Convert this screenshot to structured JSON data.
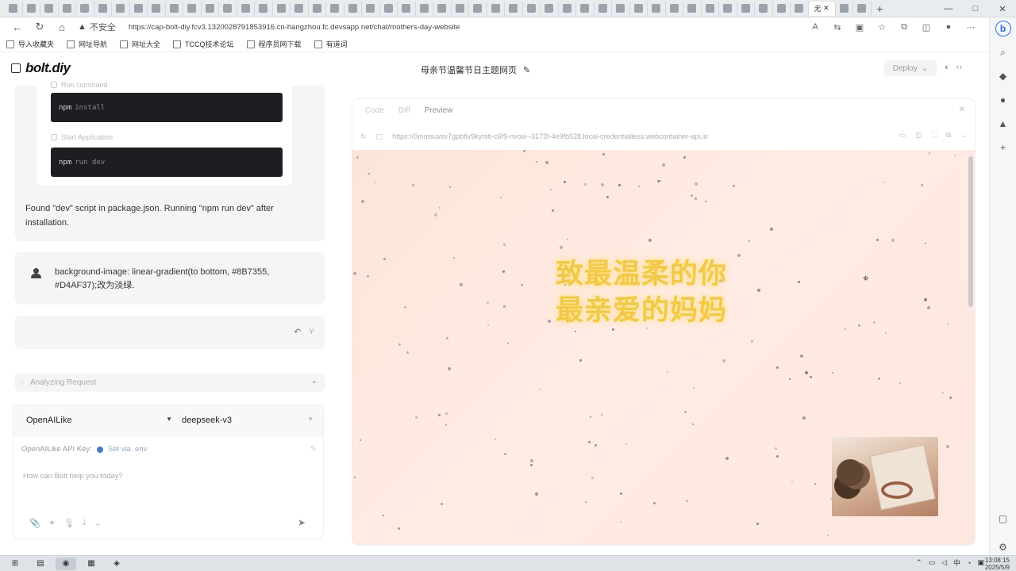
{
  "browser": {
    "active_tab_label": "无",
    "security_label": "不安全",
    "url": "https://cap-bolt-diy.fcv3.1320028791853916.cn-hangzhou.fc.devsapp.net/chat/mothers-day-website",
    "window_controls": {
      "minimize": "—",
      "maximize": "□",
      "close": "✕"
    }
  },
  "bookmarks": [
    {
      "label": "导入收藏夹"
    },
    {
      "label": "网址导航"
    },
    {
      "label": "网址大全"
    },
    {
      "label": "TCCQ技术论坛"
    },
    {
      "label": "程序员网下载"
    },
    {
      "label": "有道词"
    }
  ],
  "app": {
    "logo": "bolt.diy",
    "chat_title": "母亲节温馨节日主题网页",
    "deploy_label": "Deploy"
  },
  "chat": {
    "step1_label": "Run command",
    "cmd1_kw": "npm",
    "cmd1_arg": "install",
    "step2_label": "Start Application",
    "cmd2_kw": "npm",
    "cmd2_arg": "run dev",
    "found_text": "Found \"dev\" script in package.json. Running \"npm run dev\" after installation.",
    "user_message": "background-image: linear-gradient(to bottom, #8B7355, #D4AF37);改为淡绿.",
    "analyzing_label": "Analyzing Request"
  },
  "input": {
    "provider": "OpenAILike",
    "model": "deepseek-v3",
    "api_key_label": "OpenAILike API Key:",
    "set_via_label": "Set via .env",
    "placeholder": "How can Bolt help you today?"
  },
  "workbench": {
    "tabs": [
      "Code",
      "Diff",
      "Preview"
    ],
    "active_tab": "Preview",
    "preview_url": "https://0mmsuvsv7gpbfiv9kyrsti-c6f9-nvow--3173f-4e9fb528.local-credentialless.webcontainer-api.io"
  },
  "preview": {
    "line1": "致最温柔的你",
    "line2": "最亲爱的妈妈",
    "title_color": "#F1C94A",
    "bg_color": "#FDE6DC"
  },
  "taskbar": {
    "tray_lang": "中",
    "time": "13:08:15",
    "date": "2025/5/9"
  }
}
